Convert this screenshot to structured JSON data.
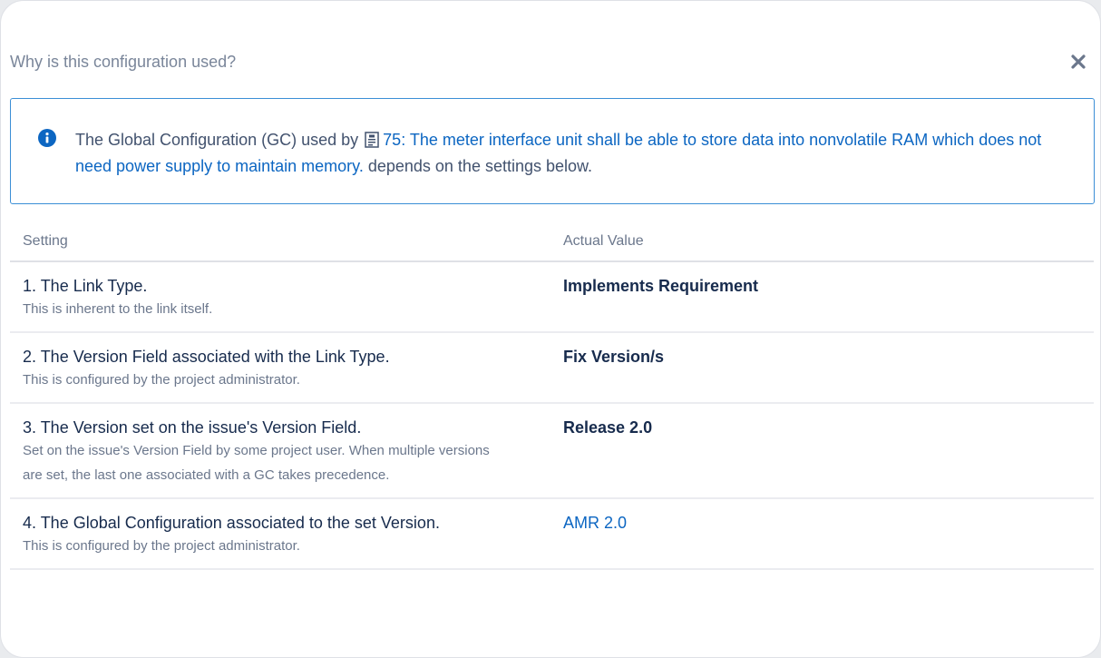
{
  "dialog": {
    "title": "Why is this configuration used?",
    "close_icon": "close-icon"
  },
  "info": {
    "icon": "info-icon",
    "prefix": "The Global Configuration (GC) used by",
    "issue_icon": "requirement-issue-icon",
    "issue_link": "75: The meter interface unit shall be able to store data into nonvolatile RAM which does not need power supply to maintain memory.",
    "suffix": "depends on the settings below."
  },
  "table": {
    "headers": {
      "setting": "Setting",
      "value": "Actual Value"
    },
    "rows": [
      {
        "label": "1. The Link Type.",
        "desc": "This is inherent to the link itself.",
        "value": "Implements Requirement"
      },
      {
        "label": "2. The Version Field associated with the Link Type.",
        "desc": "This is configured by the project administrator.",
        "value": "Fix Version/s"
      },
      {
        "label": "3. The Version set on the issue's Version Field.",
        "desc": "Set on the issue's Version Field by some project user. When multiple versions are set, the last one associated with a GC takes precedence.",
        "value": "Release 2.0"
      },
      {
        "label": "4. The Global Configuration associated to the set Version.",
        "desc": "This is configured by the project administrator.",
        "value": "AMR 2.0"
      }
    ]
  },
  "colors": {
    "link": "#0c66c2",
    "info_border": "#3b8fd6",
    "info_icon": "#0c66c2"
  }
}
